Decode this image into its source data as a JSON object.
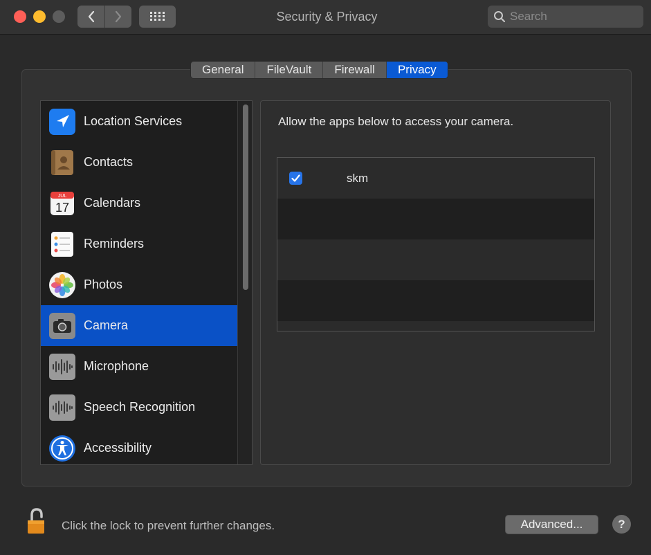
{
  "window": {
    "title": "Security & Privacy"
  },
  "search": {
    "placeholder": "Search",
    "value": ""
  },
  "tabs": [
    {
      "label": "General",
      "active": false
    },
    {
      "label": "FileVault",
      "active": false
    },
    {
      "label": "Firewall",
      "active": false
    },
    {
      "label": "Privacy",
      "active": true
    }
  ],
  "sidebar": {
    "items": [
      {
        "label": "Location Services",
        "icon": "location-arrow-icon",
        "selected": false
      },
      {
        "label": "Contacts",
        "icon": "contacts-book-icon",
        "selected": false
      },
      {
        "label": "Calendars",
        "icon": "calendar-icon",
        "selected": false
      },
      {
        "label": "Reminders",
        "icon": "reminders-list-icon",
        "selected": false
      },
      {
        "label": "Photos",
        "icon": "photos-flower-icon",
        "selected": false
      },
      {
        "label": "Camera",
        "icon": "camera-icon",
        "selected": true
      },
      {
        "label": "Microphone",
        "icon": "microphone-waveform-icon",
        "selected": false
      },
      {
        "label": "Speech Recognition",
        "icon": "speech-waveform-icon",
        "selected": false
      },
      {
        "label": "Accessibility",
        "icon": "accessibility-icon",
        "selected": false
      }
    ]
  },
  "calendar_icon": {
    "month": "JUL",
    "day": "17"
  },
  "main": {
    "heading": "Allow the apps below to access your camera.",
    "apps": [
      {
        "name": "skm",
        "checked": true
      }
    ]
  },
  "footer": {
    "lock_text": "Click the lock to prevent further changes.",
    "advanced_label": "Advanced...",
    "help_label": "?"
  },
  "colors": {
    "accent": "#0a5ad4",
    "selection": "#0a51c6",
    "checkbox": "#2774e9"
  }
}
